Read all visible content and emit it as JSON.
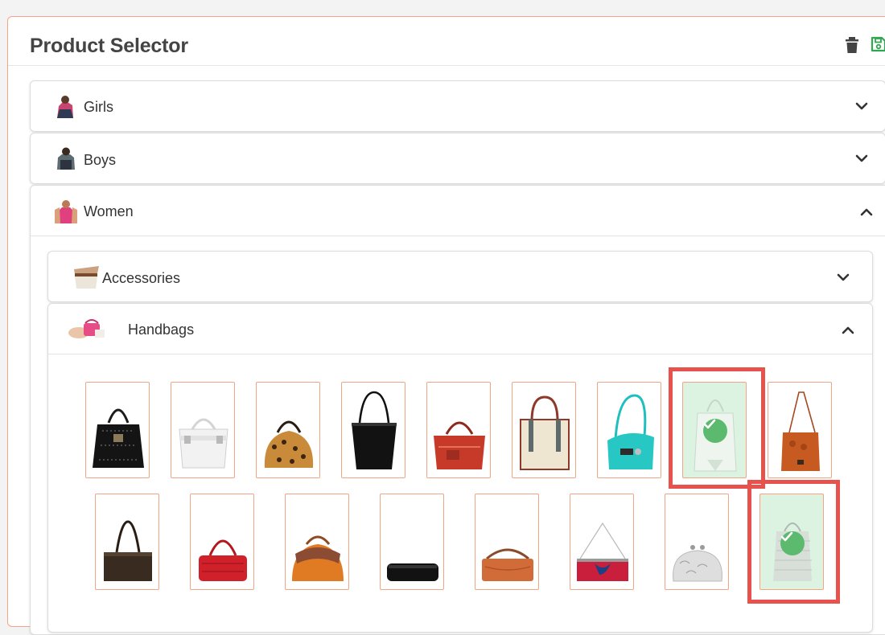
{
  "header": {
    "title": "Product Selector",
    "delete_icon": "trash-icon",
    "save_icon": "save-disk-icon",
    "accent_color": "#f0a585",
    "save_color": "#2fa84f"
  },
  "categories": [
    {
      "label": "Girls",
      "expanded": false,
      "thumb_icon": "girls-category-photo"
    },
    {
      "label": "Boys",
      "expanded": false,
      "thumb_icon": "boys-category-photo"
    },
    {
      "label": "Women",
      "expanded": true,
      "thumb_icon": "women-category-photo"
    }
  ],
  "women_subcategories": [
    {
      "label": "Accessories",
      "expanded": false,
      "thumb_icon": "accessories-category-photo"
    },
    {
      "label": "Handbags",
      "expanded": true,
      "thumb_icon": "handbags-category-photo"
    }
  ],
  "handbag_products": [
    {
      "icon": "black-studded-tote-photo",
      "selected": false
    },
    {
      "icon": "white-satchel-photo",
      "selected": false
    },
    {
      "icon": "leopard-print-bag-photo",
      "selected": false
    },
    {
      "icon": "black-tote-photo",
      "selected": false
    },
    {
      "icon": "red-satchel-photo",
      "selected": false
    },
    {
      "icon": "cream-tote-photo",
      "selected": false
    },
    {
      "icon": "turquoise-hobo-photo",
      "selected": false
    },
    {
      "icon": "white-backpack-photo",
      "selected": true
    },
    {
      "icon": "orange-crossbody-photo",
      "selected": false
    },
    {
      "icon": "brown-shoulder-bag-photo",
      "selected": false
    },
    {
      "icon": "red-croc-bag-photo",
      "selected": false
    },
    {
      "icon": "orange-frame-bag-photo",
      "selected": false
    },
    {
      "icon": "black-clutch-photo",
      "selected": false
    },
    {
      "icon": "orange-baguette-photo",
      "selected": false
    },
    {
      "icon": "red-beaded-clutch-photo",
      "selected": false
    },
    {
      "icon": "silver-kisslock-purse-photo",
      "selected": false
    },
    {
      "icon": "silver-mesh-backpack-photo",
      "selected": true
    }
  ],
  "selection": {
    "highlight_color": "#e8524d",
    "selected_bg": "#ddf3e2",
    "check_color": "#5cba6f"
  }
}
